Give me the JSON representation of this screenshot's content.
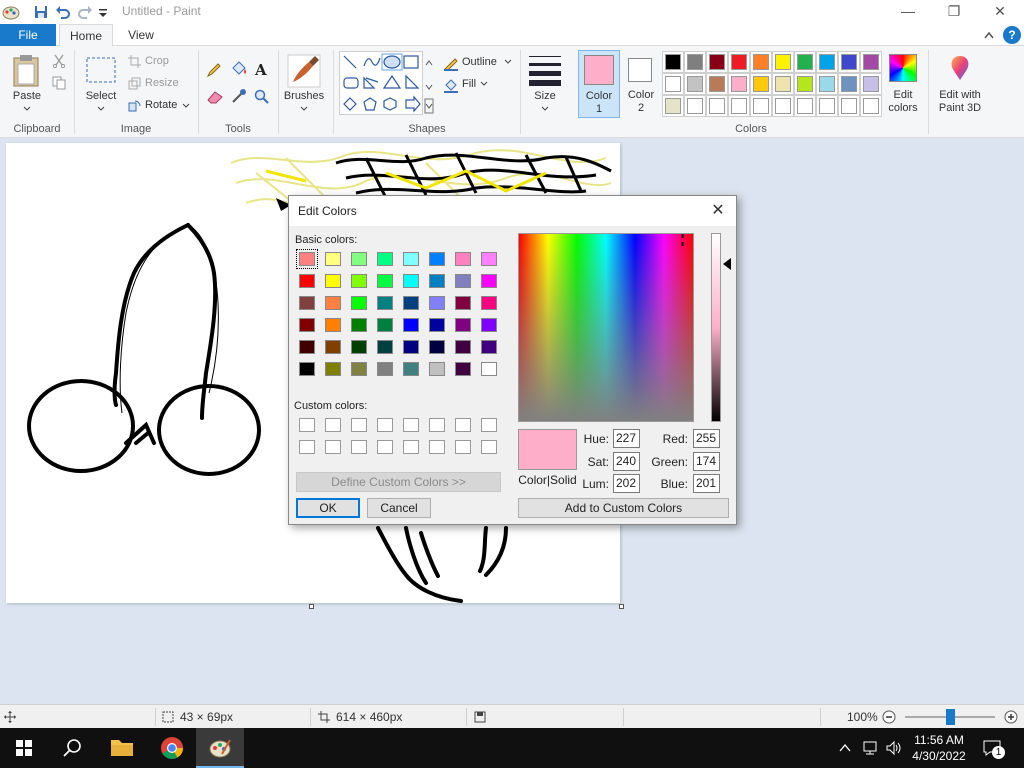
{
  "window": {
    "title": "Untitled - Paint",
    "minimize": "—",
    "maximize": "❐",
    "close": "✕"
  },
  "menu": {
    "file": "File",
    "tabs": [
      "Home",
      "View"
    ],
    "help": "?"
  },
  "ribbon": {
    "clipboard": {
      "paste": "Paste",
      "label": "Clipboard"
    },
    "image": {
      "select": "Select",
      "crop": "Crop",
      "resize": "Resize",
      "rotate": "Rotate",
      "label": "Image"
    },
    "tools": {
      "label": "Tools"
    },
    "brushes": {
      "label": "Brushes"
    },
    "shapes": {
      "outline": "Outline",
      "fill": "Fill",
      "label": "Shapes"
    },
    "size": {
      "label": "Size"
    },
    "color1": {
      "label": "Color",
      "num": "1",
      "color": "#ffaec9"
    },
    "color2": {
      "label": "Color",
      "num": "2",
      "color": "#ffffff"
    },
    "palette_row1": [
      "#000000",
      "#7f7f7f",
      "#880015",
      "#ed1c24",
      "#ff7f27",
      "#fff200",
      "#22b14c",
      "#00a2e8",
      "#3f48cc",
      "#a349a4"
    ],
    "palette_row2": [
      "#ffffff",
      "#c3c3c3",
      "#b97a57",
      "#ffaec9",
      "#ffc90e",
      "#efe4b0",
      "#b5e61d",
      "#99d9ea",
      "#7092be",
      "#c8bfe7"
    ],
    "palette_row3": [
      "#e6e4c8",
      "#ffffff",
      "#ffffff",
      "#ffffff",
      "#ffffff",
      "#ffffff",
      "#ffffff",
      "#ffffff",
      "#ffffff",
      "#ffffff"
    ],
    "edit_colors": {
      "line1": "Edit",
      "line2": "colors"
    },
    "paint3d": {
      "line1": "Edit with",
      "line2": "Paint 3D"
    },
    "colors_label": "Colors"
  },
  "dialog": {
    "title": "Edit Colors",
    "basic_colors_label": "Basic colors:",
    "basic_colors": [
      [
        "#ff8080",
        "#ffff80",
        "#80ff80",
        "#00ff80",
        "#80ffff",
        "#0080ff",
        "#ff80c0",
        "#ff80ff"
      ],
      [
        "#ff0000",
        "#ffff00",
        "#80ff00",
        "#00ff40",
        "#00ffff",
        "#0080c0",
        "#8080c0",
        "#ff00ff"
      ],
      [
        "#804040",
        "#ff8040",
        "#00ff00",
        "#008080",
        "#004080",
        "#8080ff",
        "#800040",
        "#ff0080"
      ],
      [
        "#800000",
        "#ff8000",
        "#008000",
        "#008040",
        "#0000ff",
        "#0000a0",
        "#800080",
        "#8000ff"
      ],
      [
        "#400000",
        "#804000",
        "#004000",
        "#004040",
        "#000080",
        "#000040",
        "#400040",
        "#400080"
      ],
      [
        "#000000",
        "#808000",
        "#808040",
        "#808080",
        "#408080",
        "#c0c0c0",
        "#400040",
        "#ffffff"
      ]
    ],
    "custom_colors_label": "Custom colors:",
    "define_custom": "Define Custom Colors >>",
    "ok": "OK",
    "cancel": "Cancel",
    "preview_label": "Color|Solid",
    "preview_color": "#ffaec9",
    "hue_label": "Hue:",
    "sat_label": "Sat:",
    "lum_label": "Lum:",
    "red_label": "Red:",
    "green_label": "Green:",
    "blue_label": "Blue:",
    "hue": "227",
    "sat": "240",
    "lum": "202",
    "red": "255",
    "green": "174",
    "blue": "201",
    "add_custom": "Add to Custom Colors"
  },
  "status": {
    "selection_size": "43 × 69px",
    "image_size": "614 × 460px",
    "zoom": "100%"
  },
  "taskbar": {
    "time": "11:56 AM",
    "date": "4/30/2022",
    "notifications": "1"
  }
}
